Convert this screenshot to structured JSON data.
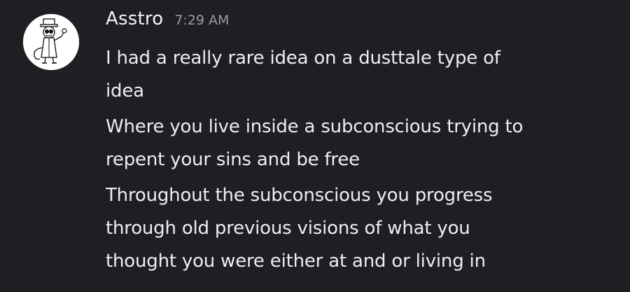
{
  "message": {
    "author": "Asstro",
    "timestamp": "7:29 AM",
    "avatar_icon": "cartoon-character-avatar-icon",
    "paragraphs": [
      {
        "lines": [
          "I had a really rare idea on a dusttale type of",
          "idea"
        ]
      },
      {
        "lines": [
          "Where you live inside a subconscious trying to",
          "repent your sins and be free"
        ]
      },
      {
        "lines": [
          "Throughout the subconscious you progress",
          "through old previous visions of what you",
          "thought you were either at and or living in"
        ]
      }
    ]
  },
  "colors": {
    "background": "#1e1f22",
    "text": "#eceef1",
    "timestamp": "#9a9ca3"
  }
}
